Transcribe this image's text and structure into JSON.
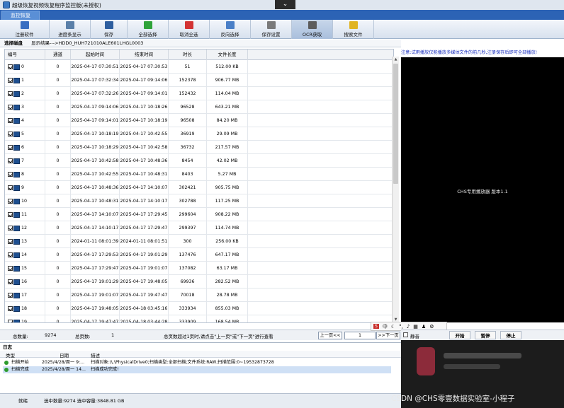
{
  "window": {
    "title": "超级恢复视频恢复程序监控版(未授权)",
    "menu_tab": "监控恢复"
  },
  "toolbar": [
    {
      "label": "注册软件",
      "icon": "register-icon",
      "color": "#3a6fc1"
    },
    {
      "label": "进度条显示",
      "icon": "progress-icon",
      "color": "#5a7fa8"
    },
    {
      "label": "保存",
      "icon": "save-icon",
      "color": "#2f5f9f"
    },
    {
      "label": "全部选择",
      "icon": "check-all-icon",
      "color": "#2fa33a"
    },
    {
      "label": "取消全选",
      "icon": "cancel-select-icon",
      "color": "#d33434"
    },
    {
      "label": "反向选择",
      "icon": "invert-select-icon",
      "color": "#4a7fc7"
    },
    {
      "label": "保存设置",
      "icon": "save-settings-icon",
      "color": "#7a7a7a"
    },
    {
      "label": "OCR获取",
      "icon": "ocr-icon",
      "color": "#5c5c5c"
    },
    {
      "label": "搜索文件",
      "icon": "search-file-icon",
      "color": "#e0b422"
    }
  ],
  "disk": {
    "label": "选择磁盘",
    "path": "显示结果--->HDD0_HUH721010ALE601LHGL0003"
  },
  "table": {
    "headers": [
      "编号",
      "通道",
      "起始时间",
      "结束时间",
      "时长",
      "文件长度"
    ],
    "rows": [
      [
        "0",
        "0",
        "2025-04-17 07:30:51",
        "2025-04-17 07:30:53",
        "51",
        "512.00 KB"
      ],
      [
        "1",
        "0",
        "2025-04-17 07:32:34",
        "2025-04-17 09:14:06",
        "152378",
        "906.77 MB"
      ],
      [
        "2",
        "0",
        "2025-04-17 07:32:26",
        "2025-04-17 09:14:01",
        "152432",
        "114.04 MB"
      ],
      [
        "3",
        "0",
        "2025-04-17 09:14:06",
        "2025-04-17 10:18:26",
        "96528",
        "643.21 MB"
      ],
      [
        "4",
        "0",
        "2025-04-17 09:14:01",
        "2025-04-17 10:18:19",
        "96508",
        "84.20 MB"
      ],
      [
        "5",
        "0",
        "2025-04-17 10:18:19",
        "2025-04-17 10:42:55",
        "36919",
        "29.09 MB"
      ],
      [
        "6",
        "0",
        "2025-04-17 10:18:29",
        "2025-04-17 10:42:58",
        "36732",
        "217.57 MB"
      ],
      [
        "7",
        "0",
        "2025-04-17 10:42:58",
        "2025-04-17 10:48:36",
        "8454",
        "42.02 MB"
      ],
      [
        "8",
        "0",
        "2025-04-17 10:42:55",
        "2025-04-17 10:48:31",
        "8403",
        "5.27 MB"
      ],
      [
        "9",
        "0",
        "2025-04-17 10:48:36",
        "2025-04-17 14:10:07",
        "302421",
        "905.75 MB"
      ],
      [
        "10",
        "0",
        "2025-04-17 10:48:31",
        "2025-04-17 14:10:17",
        "302788",
        "117.25 MB"
      ],
      [
        "11",
        "0",
        "2025-04-17 14:10:07",
        "2025-04-17 17:29:45",
        "299604",
        "908.22 MB"
      ],
      [
        "12",
        "0",
        "2025-04-17 14:10:17",
        "2025-04-17 17:29:47",
        "299397",
        "114.74 MB"
      ],
      [
        "13",
        "0",
        "2024-01-11 08:01:39",
        "2024-01-11 08:01:51",
        "300",
        "256.00 KB"
      ],
      [
        "14",
        "0",
        "2025-04-17 17:29:53",
        "2025-04-17 19:01:29",
        "137476",
        "647.17 MB"
      ],
      [
        "15",
        "0",
        "2025-04-17 17:29:47",
        "2025-04-17 19:01:07",
        "137082",
        "63.17 MB"
      ],
      [
        "16",
        "0",
        "2025-04-17 19:01:29",
        "2025-04-17 19:48:05",
        "69936",
        "282.52 MB"
      ],
      [
        "17",
        "0",
        "2025-04-17 19:01:07",
        "2025-04-17 19:47:47",
        "70018",
        "28.78 MB"
      ],
      [
        "18",
        "0",
        "2025-04-17 19:48:05",
        "2025-04-18 03:45:16",
        "333934",
        "855.03 MB"
      ],
      [
        "19",
        "0",
        "2025-04-17 19:47:47",
        "2025-04-18 03:44:28",
        "333909",
        "168.54 MB"
      ]
    ]
  },
  "status": {
    "total_label": "总数量:",
    "total": "9274",
    "pages_label": "总页数:",
    "pages": "1",
    "hint": "总页数超过1页时,请点击\"上一页\"或\"下一页\"进行查看",
    "prev": "上一页<<",
    "page_input": "1",
    "next": ">>下一页"
  },
  "ime": {
    "mode": "中"
  },
  "notice": "注意:试用播放仅能播放多媒体文件的前几秒,注册保存后即可全部播放!",
  "player": {
    "version": "CHS专用播放器 版本1.1",
    "mute": "静音",
    "play": "开始",
    "pause": "暂停",
    "stop": "停止"
  },
  "log": {
    "title": "日志",
    "columns": [
      "类型",
      "日期",
      "描述"
    ],
    "rows": [
      {
        "type": "扫描开始",
        "date": "2025/4/28/周一 9:...",
        "desc": "扫描对象:\\\\.\\PhysicalDrive0;扫描类型:全部扫描;文件系统:RAW;扫描范围:0~19532873728"
      },
      {
        "type": "扫描完成",
        "date": "2025/4/28/周一 14...",
        "desc": "扫描成功完成!"
      }
    ]
  },
  "footer": {
    "state": "就绪",
    "summary": "选中数量:9274 选中容量:3848.81 GB"
  },
  "watermark": "CSDN @CHS零壹数据实验室-小程子"
}
